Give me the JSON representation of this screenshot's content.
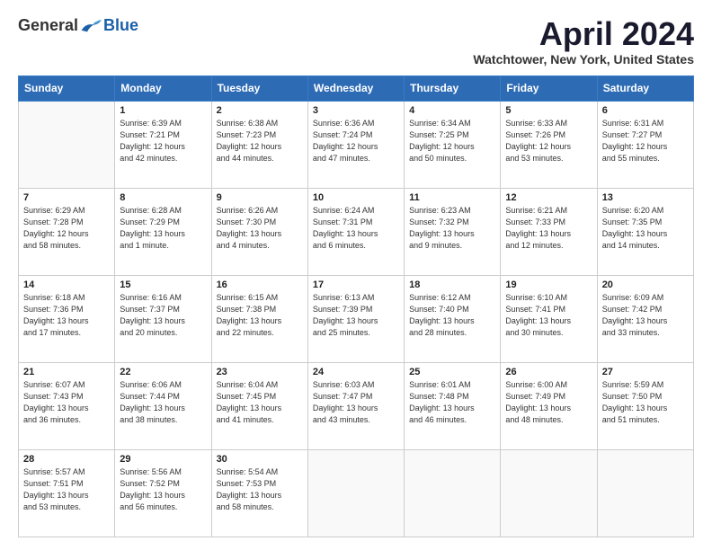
{
  "header": {
    "logo_general": "General",
    "logo_blue": "Blue",
    "title": "April 2024",
    "location": "Watchtower, New York, United States"
  },
  "days_of_week": [
    "Sunday",
    "Monday",
    "Tuesday",
    "Wednesday",
    "Thursday",
    "Friday",
    "Saturday"
  ],
  "weeks": [
    [
      {
        "day": "",
        "info": ""
      },
      {
        "day": "1",
        "info": "Sunrise: 6:39 AM\nSunset: 7:21 PM\nDaylight: 12 hours\nand 42 minutes."
      },
      {
        "day": "2",
        "info": "Sunrise: 6:38 AM\nSunset: 7:23 PM\nDaylight: 12 hours\nand 44 minutes."
      },
      {
        "day": "3",
        "info": "Sunrise: 6:36 AM\nSunset: 7:24 PM\nDaylight: 12 hours\nand 47 minutes."
      },
      {
        "day": "4",
        "info": "Sunrise: 6:34 AM\nSunset: 7:25 PM\nDaylight: 12 hours\nand 50 minutes."
      },
      {
        "day": "5",
        "info": "Sunrise: 6:33 AM\nSunset: 7:26 PM\nDaylight: 12 hours\nand 53 minutes."
      },
      {
        "day": "6",
        "info": "Sunrise: 6:31 AM\nSunset: 7:27 PM\nDaylight: 12 hours\nand 55 minutes."
      }
    ],
    [
      {
        "day": "7",
        "info": "Sunrise: 6:29 AM\nSunset: 7:28 PM\nDaylight: 12 hours\nand 58 minutes."
      },
      {
        "day": "8",
        "info": "Sunrise: 6:28 AM\nSunset: 7:29 PM\nDaylight: 13 hours\nand 1 minute."
      },
      {
        "day": "9",
        "info": "Sunrise: 6:26 AM\nSunset: 7:30 PM\nDaylight: 13 hours\nand 4 minutes."
      },
      {
        "day": "10",
        "info": "Sunrise: 6:24 AM\nSunset: 7:31 PM\nDaylight: 13 hours\nand 6 minutes."
      },
      {
        "day": "11",
        "info": "Sunrise: 6:23 AM\nSunset: 7:32 PM\nDaylight: 13 hours\nand 9 minutes."
      },
      {
        "day": "12",
        "info": "Sunrise: 6:21 AM\nSunset: 7:33 PM\nDaylight: 13 hours\nand 12 minutes."
      },
      {
        "day": "13",
        "info": "Sunrise: 6:20 AM\nSunset: 7:35 PM\nDaylight: 13 hours\nand 14 minutes."
      }
    ],
    [
      {
        "day": "14",
        "info": "Sunrise: 6:18 AM\nSunset: 7:36 PM\nDaylight: 13 hours\nand 17 minutes."
      },
      {
        "day": "15",
        "info": "Sunrise: 6:16 AM\nSunset: 7:37 PM\nDaylight: 13 hours\nand 20 minutes."
      },
      {
        "day": "16",
        "info": "Sunrise: 6:15 AM\nSunset: 7:38 PM\nDaylight: 13 hours\nand 22 minutes."
      },
      {
        "day": "17",
        "info": "Sunrise: 6:13 AM\nSunset: 7:39 PM\nDaylight: 13 hours\nand 25 minutes."
      },
      {
        "day": "18",
        "info": "Sunrise: 6:12 AM\nSunset: 7:40 PM\nDaylight: 13 hours\nand 28 minutes."
      },
      {
        "day": "19",
        "info": "Sunrise: 6:10 AM\nSunset: 7:41 PM\nDaylight: 13 hours\nand 30 minutes."
      },
      {
        "day": "20",
        "info": "Sunrise: 6:09 AM\nSunset: 7:42 PM\nDaylight: 13 hours\nand 33 minutes."
      }
    ],
    [
      {
        "day": "21",
        "info": "Sunrise: 6:07 AM\nSunset: 7:43 PM\nDaylight: 13 hours\nand 36 minutes."
      },
      {
        "day": "22",
        "info": "Sunrise: 6:06 AM\nSunset: 7:44 PM\nDaylight: 13 hours\nand 38 minutes."
      },
      {
        "day": "23",
        "info": "Sunrise: 6:04 AM\nSunset: 7:45 PM\nDaylight: 13 hours\nand 41 minutes."
      },
      {
        "day": "24",
        "info": "Sunrise: 6:03 AM\nSunset: 7:47 PM\nDaylight: 13 hours\nand 43 minutes."
      },
      {
        "day": "25",
        "info": "Sunrise: 6:01 AM\nSunset: 7:48 PM\nDaylight: 13 hours\nand 46 minutes."
      },
      {
        "day": "26",
        "info": "Sunrise: 6:00 AM\nSunset: 7:49 PM\nDaylight: 13 hours\nand 48 minutes."
      },
      {
        "day": "27",
        "info": "Sunrise: 5:59 AM\nSunset: 7:50 PM\nDaylight: 13 hours\nand 51 minutes."
      }
    ],
    [
      {
        "day": "28",
        "info": "Sunrise: 5:57 AM\nSunset: 7:51 PM\nDaylight: 13 hours\nand 53 minutes."
      },
      {
        "day": "29",
        "info": "Sunrise: 5:56 AM\nSunset: 7:52 PM\nDaylight: 13 hours\nand 56 minutes."
      },
      {
        "day": "30",
        "info": "Sunrise: 5:54 AM\nSunset: 7:53 PM\nDaylight: 13 hours\nand 58 minutes."
      },
      {
        "day": "",
        "info": ""
      },
      {
        "day": "",
        "info": ""
      },
      {
        "day": "",
        "info": ""
      },
      {
        "day": "",
        "info": ""
      }
    ]
  ]
}
